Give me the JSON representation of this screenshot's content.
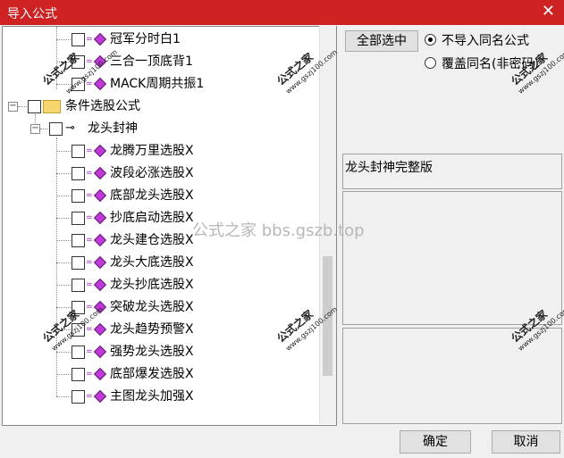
{
  "window": {
    "title": "导入公式",
    "close_glyph": "✕"
  },
  "tree": {
    "top_items": [
      {
        "label": "冠军分时白1"
      },
      {
        "label": "三合一顶底背1"
      },
      {
        "label": "MACK周期共振1"
      }
    ],
    "group": {
      "label": "条件选股公式"
    },
    "subgroup": {
      "label": "龙头封神"
    },
    "items": [
      {
        "label": "龙腾万里选股X"
      },
      {
        "label": "波段必涨选股X"
      },
      {
        "label": "底部龙头选股X"
      },
      {
        "label": "抄底启动选股X"
      },
      {
        "label": "龙头建仓选股X"
      },
      {
        "label": "龙头大底选股X"
      },
      {
        "label": "龙头抄底选股X"
      },
      {
        "label": "突破龙头选股X"
      },
      {
        "label": "龙头趋势预警X"
      },
      {
        "label": "强势龙头选股X"
      },
      {
        "label": "底部爆发选股X"
      },
      {
        "label": "主图龙头加强X"
      }
    ]
  },
  "options": {
    "select_all": "全部选中",
    "radio_skip": "不导入同名公式",
    "radio_overwrite": "覆盖同名(非密码)"
  },
  "description": "龙头封神完整版",
  "footer": {
    "ok": "确定",
    "cancel": "取消"
  },
  "watermark": {
    "cn": "公式之家",
    "url_small": "www.gszj100.com",
    "center": "公式之家 bbs.gszb.top"
  }
}
